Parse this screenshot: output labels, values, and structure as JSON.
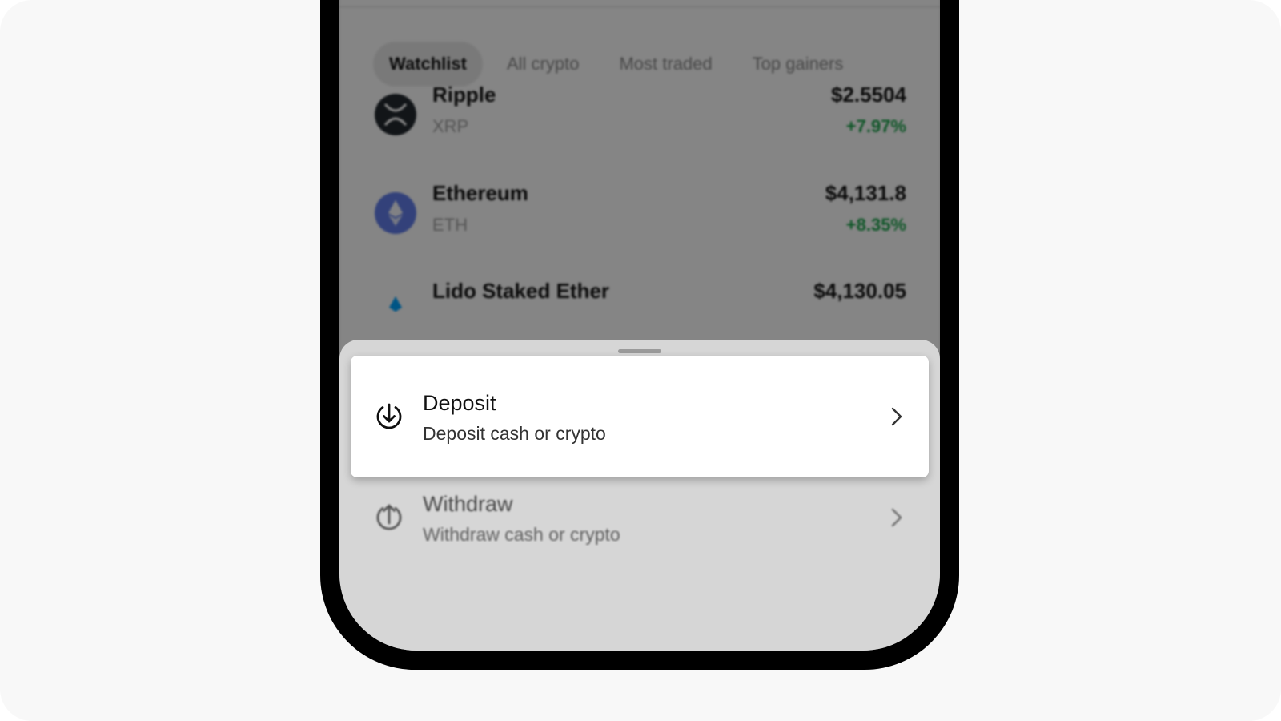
{
  "tabs": [
    {
      "label": "Watchlist",
      "active": true
    },
    {
      "label": "All crypto",
      "active": false
    },
    {
      "label": "Most traded",
      "active": false
    },
    {
      "label": "Top gainers",
      "active": false
    }
  ],
  "assets": [
    {
      "name": "Ripple",
      "ticker": "XRP",
      "price": "$2.5504",
      "change": "+7.97%",
      "icon": "xrp-icon"
    },
    {
      "name": "Ethereum",
      "ticker": "ETH",
      "price": "$4,131.8",
      "change": "+8.35%",
      "icon": "eth-icon"
    },
    {
      "name": "Lido Staked Ether",
      "ticker": "",
      "price": "$4,130.05",
      "change": "",
      "icon": "steth-icon"
    }
  ],
  "sheet": {
    "options": [
      {
        "title": "Deposit",
        "subtitle": "Deposit cash or crypto",
        "icon": "deposit-arrow-down-icon"
      },
      {
        "title": "Withdraw",
        "subtitle": "Withdraw cash or crypto",
        "icon": "withdraw-arrow-up-icon"
      }
    ]
  },
  "colors": {
    "positive": "#1aa34a",
    "eth": "#627eea",
    "backdrop": "#f8f8f8"
  }
}
